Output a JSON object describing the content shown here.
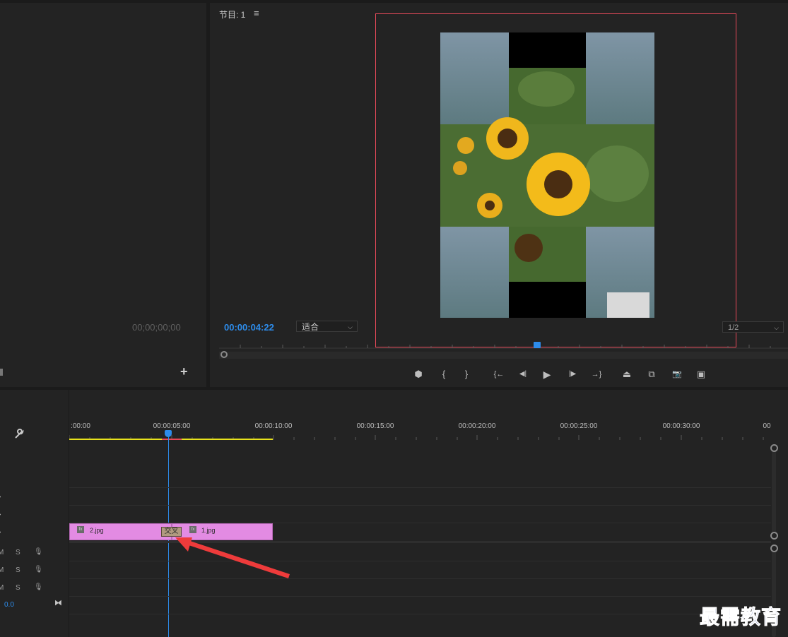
{
  "source_monitor": {
    "timecode": "00;00;00;00",
    "add_symbol": "+"
  },
  "program_monitor": {
    "title": "节目: 1",
    "menu_symbol": "≡",
    "timecode": "00:00:04:22",
    "fit": "适合",
    "resolution": "1/2",
    "controls": [
      {
        "name": "add-marker-button",
        "glyph": "⬢"
      },
      {
        "name": "mark-in-button",
        "glyph": "{"
      },
      {
        "name": "mark-out-button",
        "glyph": "}"
      },
      {
        "name": "go-to-in-button",
        "glyph": "{←"
      },
      {
        "name": "step-back-button",
        "glyph": "◀|"
      },
      {
        "name": "play-button",
        "glyph": "▶"
      },
      {
        "name": "step-forward-button",
        "glyph": "|▶"
      },
      {
        "name": "go-to-out-button",
        "glyph": "→}"
      },
      {
        "name": "lift-button",
        "glyph": "⏏"
      },
      {
        "name": "extract-button",
        "glyph": "⧉"
      },
      {
        "name": "export-frame-button",
        "glyph": "📷"
      },
      {
        "name": "compare-view-button",
        "glyph": "▣"
      }
    ]
  },
  "timeline": {
    "ruler_labels": [
      ":00:00",
      "00:00:05:00",
      "00:00:10:00",
      "00:00:15:00",
      "00:00:20:00",
      "00:00:25:00",
      "00:00:30:00",
      "00"
    ],
    "clips": [
      {
        "name": "2.jpg",
        "fx": "fx"
      },
      {
        "name": "1.jpg",
        "fx": "fx"
      }
    ],
    "transition_label": "交叉",
    "audio_tracks": [
      {
        "mute": "M",
        "solo": "S"
      },
      {
        "mute": "M",
        "solo": "S"
      },
      {
        "mute": "M",
        "solo": "S"
      }
    ],
    "master_value": "0.0"
  },
  "watermark": "最需教育",
  "colors": {
    "accent_blue": "#2d8ceb",
    "clip_pink": "#e38be3",
    "work_area_yellow": "#e8e21c",
    "highlight_red": "#e84a5a"
  }
}
